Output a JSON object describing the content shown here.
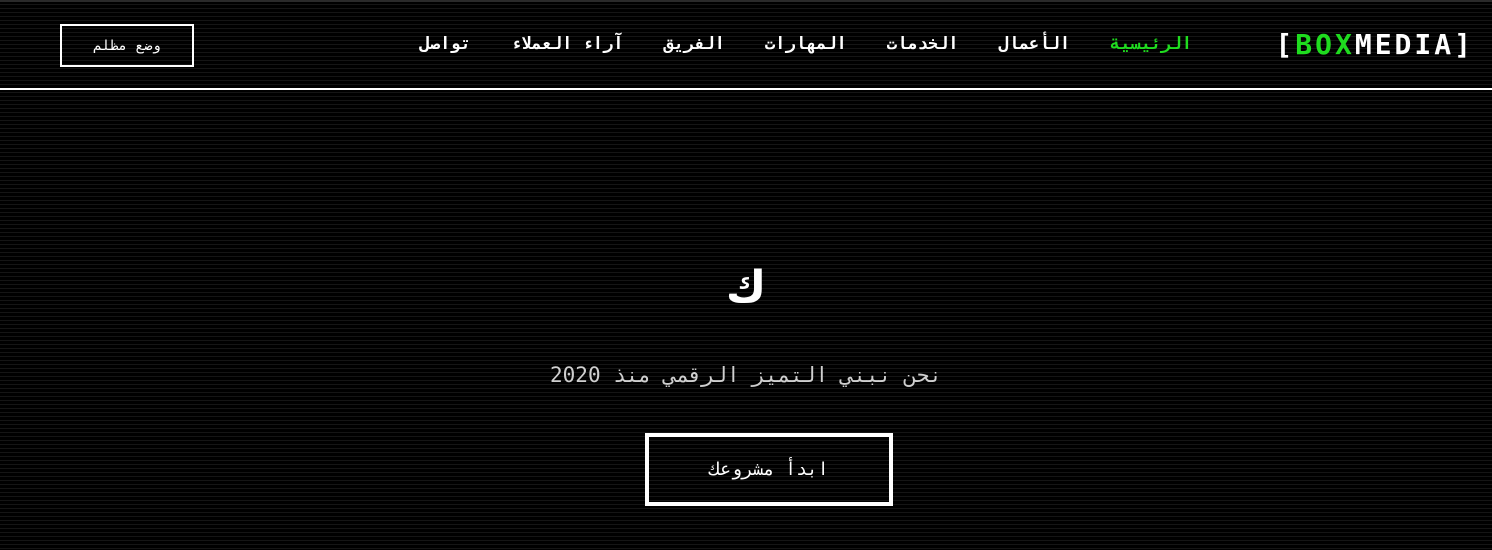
{
  "header": {
    "logo": {
      "open_bracket": "[",
      "box": "BOX",
      "media": "MEDIA",
      "close_bracket": "]"
    },
    "nav": [
      {
        "label": "الرئيسية",
        "active": true
      },
      {
        "label": "الأعمال",
        "active": false
      },
      {
        "label": "الخدمات",
        "active": false
      },
      {
        "label": "المهارات",
        "active": false
      },
      {
        "label": "الفريق",
        "active": false
      },
      {
        "label": "آراء العملاء",
        "active": false
      },
      {
        "label": "تواصل",
        "active": false
      }
    ],
    "dark_mode_label": "وضع مظلم"
  },
  "hero": {
    "title": "ك",
    "subtitle": "نحن نبني التميز الرقمي منذ 2020",
    "cta_label": "ابدأ مشروعك"
  },
  "colors": {
    "accent": "#1fdc1f",
    "background": "#000000",
    "text": "#ffffff"
  }
}
